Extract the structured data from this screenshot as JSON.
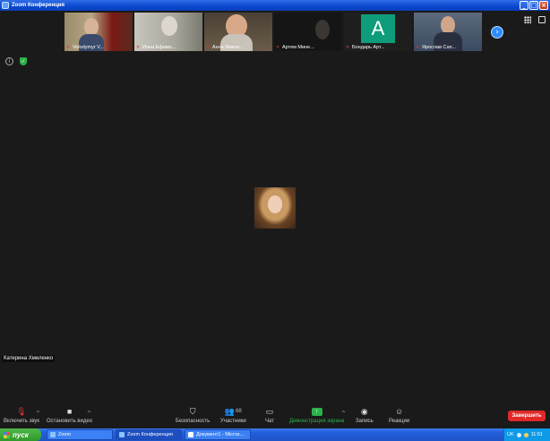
{
  "window": {
    "title": "Zoom Конференция"
  },
  "thumbnails": [
    {
      "name": "Volodymyr V...",
      "muted": true
    },
    {
      "name": "Инна Ефимо...",
      "muted": true
    },
    {
      "name": "Анна Макси...",
      "muted": true
    },
    {
      "name": "Артем Мине...",
      "muted": true
    },
    {
      "name": "Бондарь Арт...",
      "muted": true,
      "avatar_letter": "A"
    },
    {
      "name": "Ярослав Сап...",
      "muted": true
    }
  ],
  "speaker": {
    "name": "Катерина Хмеленко"
  },
  "toolbar": {
    "audio_label": "Включить звук",
    "video_label": "Остановить видео",
    "security_label": "Безопасность",
    "participants_label": "Участники",
    "participants_count": "68",
    "chat_label": "Чат",
    "share_label": "Демонстрация экрана",
    "record_label": "Запись",
    "reactions_label": "Реакции",
    "end_label": "Завершить"
  },
  "taskbar": {
    "start_label": "пуск",
    "tasks": [
      "Zoom",
      "Zoom Конференция",
      "Документ1 - Micros..."
    ],
    "lang": "UK",
    "time": "11:51"
  },
  "colors": {
    "accent": "#2d8cff",
    "end": "#e02828",
    "share": "#2bb14a"
  }
}
